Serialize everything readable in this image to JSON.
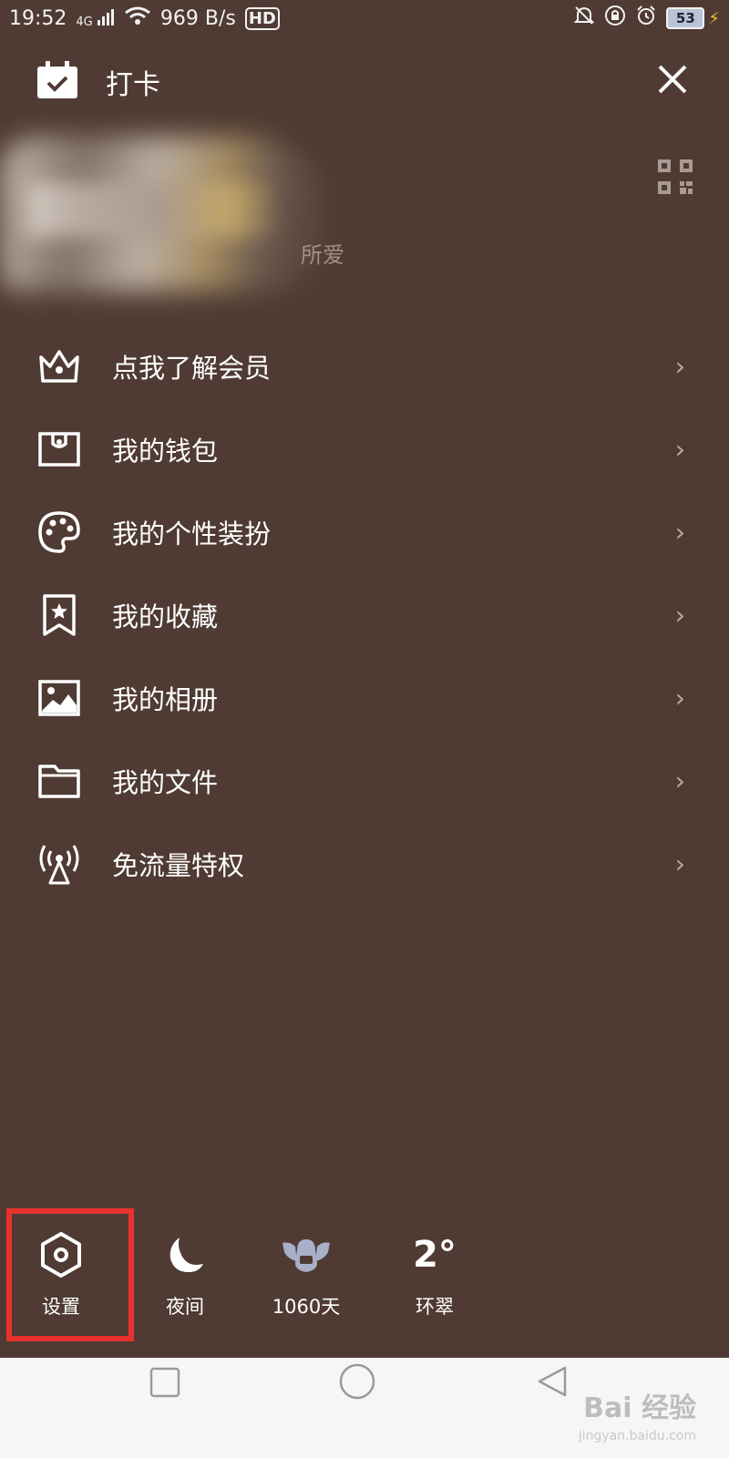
{
  "status_bar": {
    "time": "19:52",
    "signal": "4G",
    "speed": "969 B/s",
    "hd": "HD",
    "battery": "53",
    "icons": [
      "mute-bell-icon",
      "lock-rotate-icon",
      "alarm-icon",
      "battery-icon",
      "charging-icon"
    ]
  },
  "header": {
    "checkin_label": "打卡",
    "checkin_icon": "calendar-check-icon",
    "close_icon": "close-icon"
  },
  "profile": {
    "signature": "所爱",
    "qr_icon": "qr-code-icon"
  },
  "menu": {
    "items": [
      {
        "label": "点我了解会员",
        "icon": "crown-icon"
      },
      {
        "label": "我的钱包",
        "icon": "wallet-icon"
      },
      {
        "label": "我的个性装扮",
        "icon": "palette-icon"
      },
      {
        "label": "我的收藏",
        "icon": "bookmark-star-icon"
      },
      {
        "label": "我的相册",
        "icon": "image-icon"
      },
      {
        "label": "我的文件",
        "icon": "folder-icon"
      },
      {
        "label": "免流量特权",
        "icon": "antenna-icon"
      }
    ],
    "chevron": "›"
  },
  "bottom_tools": {
    "settings": {
      "label": "设置",
      "icon": "settings-hexagon-icon"
    },
    "night": {
      "label": "夜间",
      "icon": "moon-icon"
    },
    "days": {
      "label": "1060天",
      "icon": "winged-penguin-icon"
    },
    "weather": {
      "value": "2°",
      "label": "环翠"
    }
  },
  "nav_bar": {
    "icons": [
      "recent-apps-square-icon",
      "home-circle-icon",
      "back-triangle-icon"
    ]
  },
  "watermark": {
    "brand": "Bai 经验",
    "url": "jingyan.baidu.com"
  },
  "colors": {
    "background": "#4f3b33",
    "highlight": "#e8322f",
    "nav_background": "#f6f6f6"
  }
}
